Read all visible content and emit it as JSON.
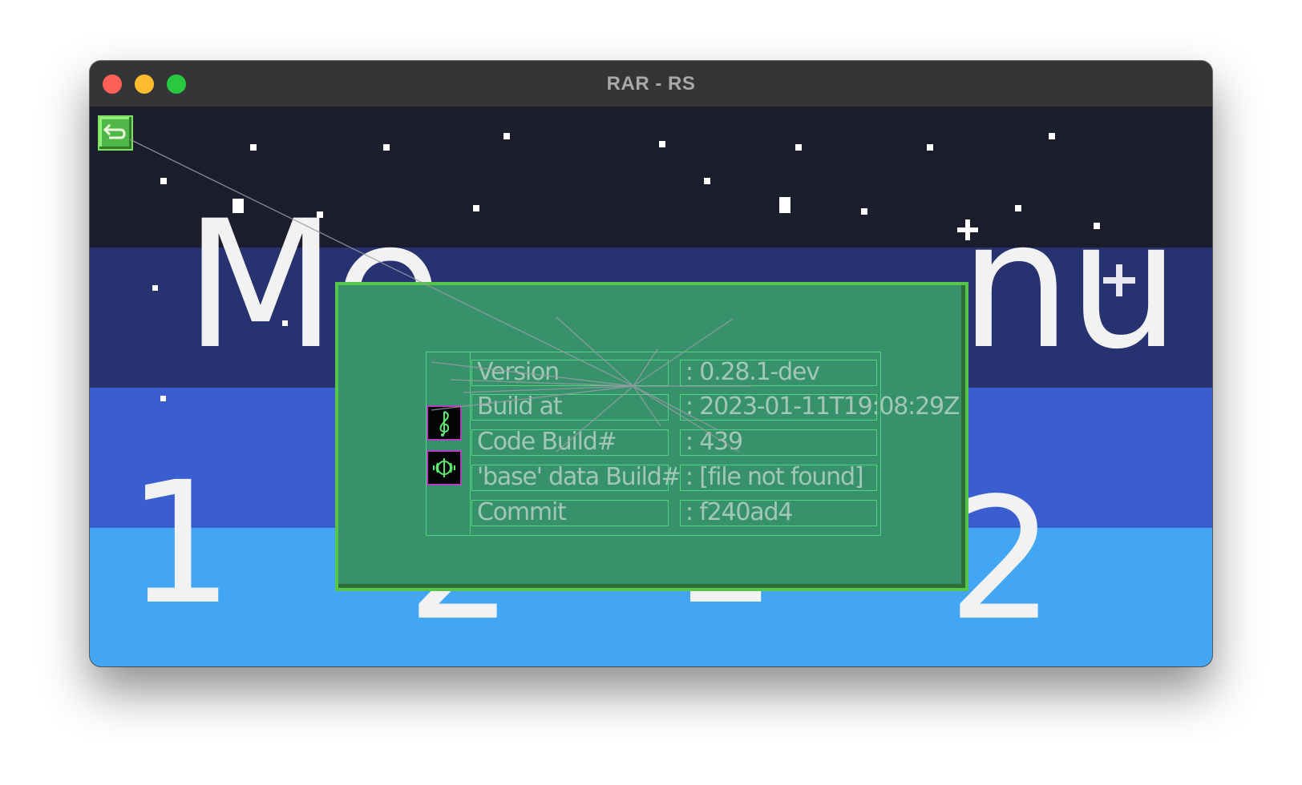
{
  "window": {
    "title": "RAR - RS"
  },
  "background": {
    "menu_left_text": "Me",
    "menu_right_text": "nu",
    "numbers": [
      "1",
      "2",
      "1",
      "2"
    ],
    "band_colors": [
      "#1b1d2c",
      "#273270",
      "#3a5ecf",
      "#43a6f4"
    ]
  },
  "toolbar": {
    "back_icon": "back-arrow-icon"
  },
  "info_dialog": {
    "icons": [
      "music-note-icon",
      "sound-icon"
    ],
    "rows": [
      {
        "label": "Version",
        "value": ": 0.28.1-dev"
      },
      {
        "label": "Build at",
        "value": ": 2023-01-11T19:08:29Z"
      },
      {
        "label": "Code Build#",
        "value": ": 439"
      },
      {
        "label": "'base' data Build#",
        "value": ": [file not found]"
      },
      {
        "label": "Commit",
        "value": ": f240ad4"
      }
    ]
  },
  "colors": {
    "dialog_bg": "#37926c",
    "dialog_border": "#55c64a",
    "table_border": "#4fd67a",
    "text": "#a2c7b5",
    "icon_border": "#b23ec2"
  }
}
